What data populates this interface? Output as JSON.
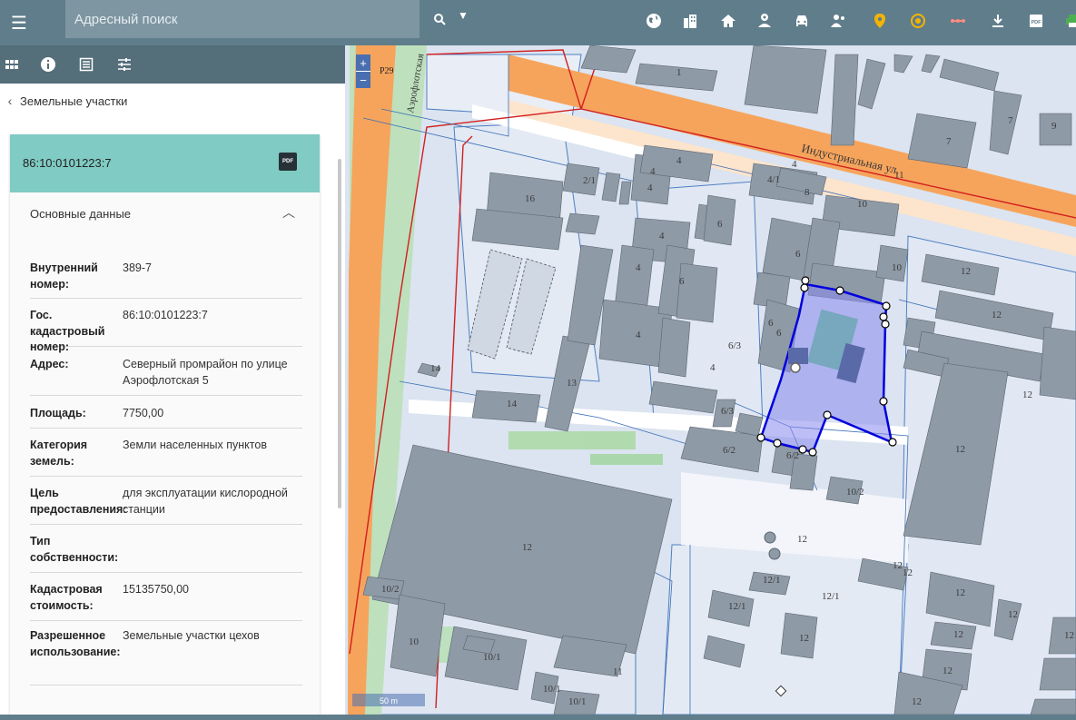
{
  "topbar": {
    "menu_icon": "menu-icon",
    "search_placeholder": "Адресный поиск",
    "search_icon": "search-icon",
    "tool_icons": [
      "globe-icon",
      "buildings-icon",
      "home-icon",
      "location-badge-icon",
      "car-icon",
      "people-icon",
      "map-pin-icon",
      "target-icon",
      "measure-icon",
      "download-icon",
      "pdf-icon",
      "print-icon"
    ],
    "colors": {
      "bar": "#607d8b",
      "search": "#7d96a2",
      "pin": "#f5b400"
    }
  },
  "panel": {
    "toolbar_icons": [
      "grid-icon",
      "info-icon",
      "list-icon",
      "filter-settings-icon"
    ],
    "breadcrumb": "Земельные участки",
    "card": {
      "title": "86:10:0101223:7",
      "pdf_label": "PDF",
      "section_title": "Основные данные",
      "rows": [
        {
          "key": "Внутренний номер:",
          "value": "389-7"
        },
        {
          "key": "Гос. кадастровый номер:",
          "value": "86:10:0101223:7"
        },
        {
          "key": "Адрес:",
          "value": "Северный промрайон по улице Аэрофлотская 5"
        },
        {
          "key": "Площадь:",
          "value": "7750,00"
        },
        {
          "key": "Категория земель:",
          "value": "Земли населенных пунктов"
        },
        {
          "key": "Цель предоставления:",
          "value": "для эксплуатации кислородной станции"
        },
        {
          "key": "Тип собственности:",
          "value": ""
        },
        {
          "key": "Кадастровая стоимость:",
          "value": "15135750,00"
        },
        {
          "key": "Разрешенное использование:",
          "value": "Земельные участки цехов"
        }
      ]
    },
    "colors": {
      "toolbar": "#546e7a",
      "card_header": "#80cbc4"
    }
  },
  "map": {
    "zoom_in": "+",
    "zoom_out": "−",
    "road_labels": [
      "Р29",
      "Аэрофлотская",
      "Индустриальная ул.",
      "11"
    ],
    "scale": "50 m",
    "building_numbers": [
      "1",
      "7",
      "7",
      "9",
      "4",
      "4",
      "4",
      "2/1",
      "4",
      "4/1",
      "8",
      "10",
      "10",
      "6",
      "6",
      "12",
      "12",
      "16",
      "4",
      "4",
      "4",
      "6",
      "6",
      "6/3",
      "6",
      "4",
      "14",
      "13",
      "14",
      "12",
      "6/3",
      "12",
      "6/2",
      "6/2",
      "10/2",
      "12",
      "12",
      "12",
      "12/1",
      "12/1",
      "12",
      "12/1",
      "12",
      "12",
      "12",
      "10/2",
      "10",
      "10/1",
      "11",
      "10/1",
      "10/1",
      "12",
      "12",
      "12",
      "12"
    ],
    "colors": {
      "selected_parcel": "#0000dd",
      "selected_fill": "#8888ee",
      "road": "#f6a45c",
      "parcel_line": "#3b6fb6",
      "red_line": "#d21f1f",
      "building": "#8e9aa6"
    }
  }
}
